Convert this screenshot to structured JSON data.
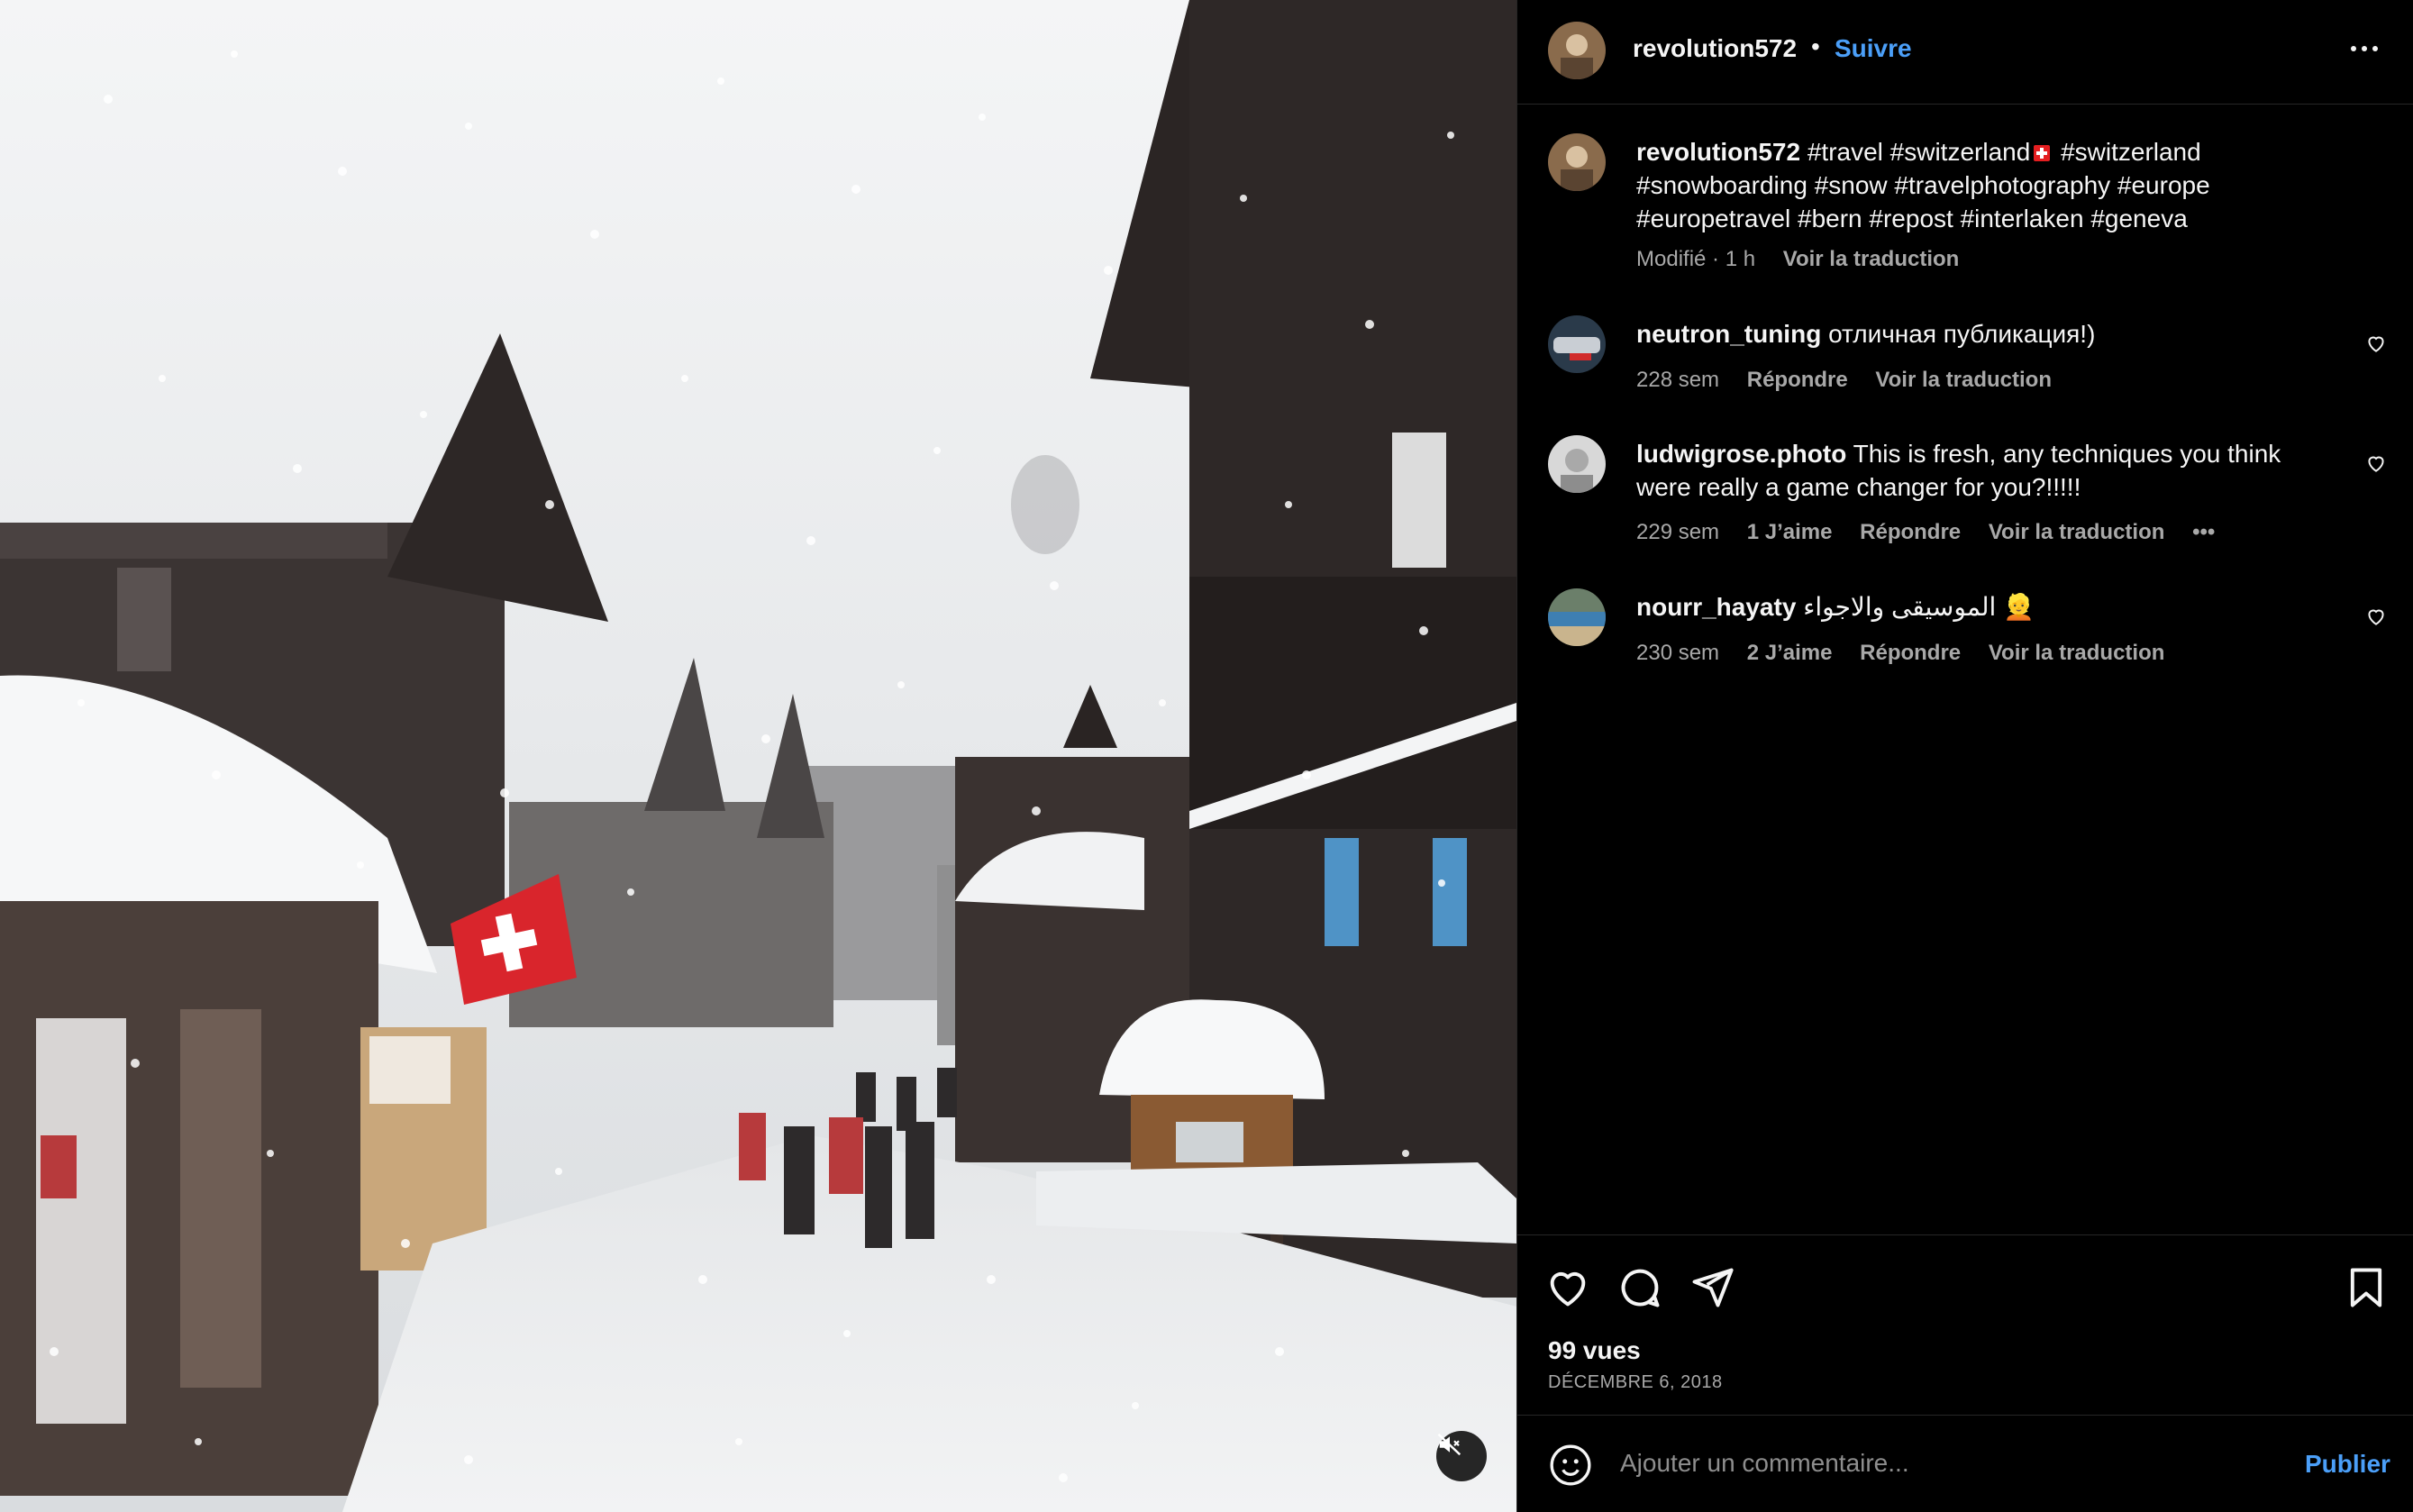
{
  "post": {
    "username": "revolution572",
    "separator": "•",
    "follow_label": "Suivre",
    "more_icon": "more-horizontal-icon"
  },
  "caption": {
    "username": "revolution572",
    "text_before_flag": "#travel #switzerland",
    "text_after_flag": " #switzerland #snowboarding #snow #travelphotography #europe #europetravel #bern #repost #interlaken #geneva",
    "edited_label": "Modifié · 1 h",
    "translate_label": "Voir la traduction"
  },
  "comments": [
    {
      "username": "neutron_tuning",
      "text": "отличная публикация!)",
      "age": "228 sem",
      "likes": "",
      "reply_label": "Répondre",
      "translate_label": "Voir la traduction"
    },
    {
      "username": "ludwigrose.photo",
      "text": "This is fresh, any techniques you think were really a game changer for you?!!!!!",
      "age": "229 sem",
      "likes": "1 J’aime",
      "reply_label": "Répondre",
      "translate_label": "Voir la traduction",
      "more_label": "•••"
    },
    {
      "username": "nourr_hayaty",
      "text": "الموسيقى والاجواء 👱",
      "age": "230 sem",
      "likes": "2 J’aime",
      "reply_label": "Répondre",
      "translate_label": "Voir la traduction"
    }
  ],
  "stats": {
    "views": "99 vues",
    "date": "DÉCEMBRE 6, 2018"
  },
  "composer": {
    "placeholder": "Ajouter un commentaire...",
    "publish_label": "Publier"
  },
  "colors": {
    "accent": "#4b9ff8",
    "background": "#000000",
    "muted_text": "#a8a8a8",
    "divider": "#262626"
  }
}
